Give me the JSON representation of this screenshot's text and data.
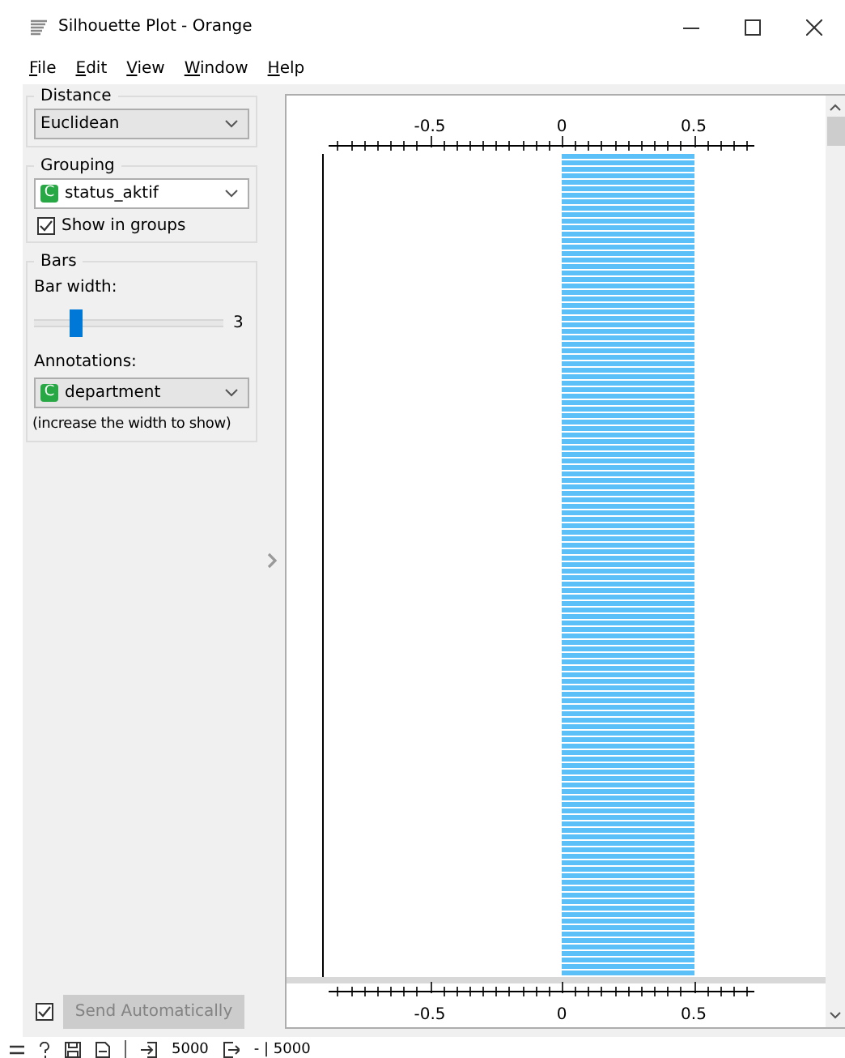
{
  "window": {
    "title": "Silhouette Plot - Orange"
  },
  "menu": [
    "File",
    "Edit",
    "View",
    "Window",
    "Help"
  ],
  "distance": {
    "title": "Distance",
    "value": "Euclidean"
  },
  "grouping": {
    "title": "Grouping",
    "value": "status_aktif",
    "value_type": "C",
    "show_in_groups": {
      "label": "Show in groups",
      "checked": true
    }
  },
  "bars": {
    "title": "Bars",
    "bar_width": {
      "label": "Bar width:",
      "level": 0.22,
      "reading": "3"
    },
    "annotations": {
      "label": "Annotations:",
      "value": "department",
      "value_type": "C"
    },
    "note": "(increase the width to show)"
  },
  "plot": {
    "top_axis": [
      "-0.5",
      "0",
      "0.5"
    ],
    "bottom_axis": [
      "-0.5",
      "0",
      "0.5"
    ]
  },
  "send": {
    "label": "Send Automatically",
    "checked": true,
    "disabled": true
  },
  "status_bar": {
    "input": "5000",
    "output": "- | 5000"
  }
}
